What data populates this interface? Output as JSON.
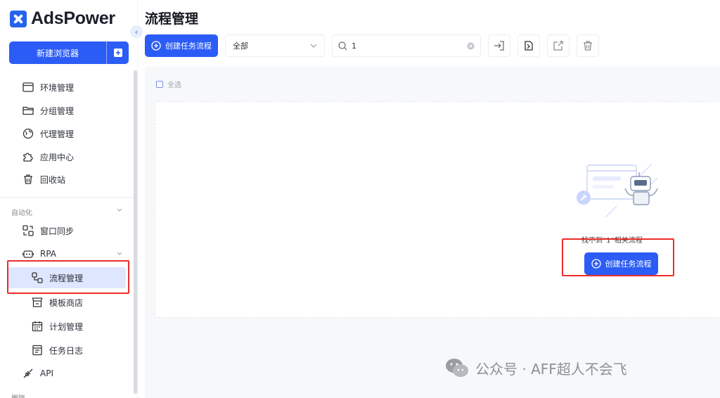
{
  "brand": {
    "name": "AdsPower"
  },
  "sidebar": {
    "new_browser_label": "新建浏览器",
    "items": [
      {
        "label": "环境管理",
        "icon": "browser-window-icon"
      },
      {
        "label": "分组管理",
        "icon": "folder-icon"
      },
      {
        "label": "代理管理",
        "icon": "globe-icon"
      },
      {
        "label": "应用中心",
        "icon": "puzzle-icon"
      },
      {
        "label": "回收站",
        "icon": "trash-icon"
      }
    ],
    "automation_section": "自动化",
    "automation_items": [
      {
        "label": "窗口同步",
        "icon": "sync-windows-icon"
      },
      {
        "label": "RPA",
        "icon": "robot-icon"
      },
      {
        "label": "流程管理",
        "icon": "flow-icon",
        "active": true
      },
      {
        "label": "模板商店",
        "icon": "store-icon"
      },
      {
        "label": "计划管理",
        "icon": "calendar-icon"
      },
      {
        "label": "任务日志",
        "icon": "log-icon"
      },
      {
        "label": "API",
        "icon": "api-icon"
      }
    ],
    "next_section": "團隊"
  },
  "main": {
    "title": "流程管理",
    "create_button": "创建任务流程",
    "filter": {
      "value": "全部"
    },
    "search": {
      "value": "1"
    },
    "select_all": "全选",
    "empty_text": "找不到“1”相关流程",
    "empty_create_button": "创建任务流程"
  },
  "watermark": "公众号 · AFF超人不会飞",
  "colors": {
    "primary": "#2b5cf6",
    "active_bg": "#dfe6ff",
    "highlight_box": "#ef2b2b"
  }
}
